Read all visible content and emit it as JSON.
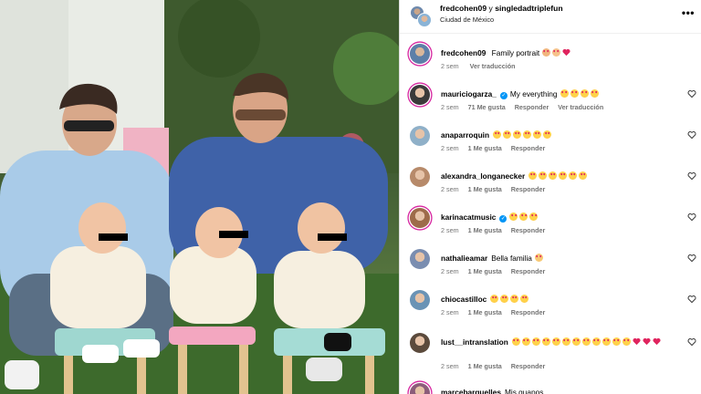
{
  "header": {
    "user1": "fredcohen09",
    "conj": "y",
    "user2": "singledadtriplefun",
    "location": "Ciudad de México",
    "more_icon": "more-horizontal-icon"
  },
  "caption": {
    "username": "fredcohen09",
    "text": "Family portrait",
    "emojis": [
      "man-face",
      "baby-face",
      "red-heart"
    ],
    "time": "2 sem",
    "translation": "Ver traducción"
  },
  "comments": [
    {
      "username": "mauriciogarza_",
      "verified": true,
      "text": "My everything",
      "emoji_count": 4,
      "time": "2 sem",
      "likes": "71 Me gusta",
      "reply": "Responder",
      "translation": "Ver traducción",
      "avatar_color": "#3a3a3a",
      "ring": true
    },
    {
      "username": "anaparroquin",
      "verified": false,
      "text": "",
      "emoji_count": 6,
      "time": "2 sem",
      "likes": "1 Me gusta",
      "reply": "Responder",
      "avatar_color": "#8fb0c8",
      "ring": false
    },
    {
      "username": "alexandra_longanecker",
      "verified": false,
      "text": "",
      "emoji_count": 6,
      "time": "2 sem",
      "likes": "1 Me gusta",
      "reply": "Responder",
      "avatar_color": "#b78a6a",
      "ring": false
    },
    {
      "username": "karinacatmusic",
      "verified": true,
      "text": "",
      "emoji_count": 3,
      "time": "2 sem",
      "likes": "1 Me gusta",
      "reply": "Responder",
      "avatar_color": "#9d6b4a",
      "ring": true
    },
    {
      "username": "nathalieamar",
      "verified": false,
      "text": "Bella familia",
      "emoji_count": 0,
      "wave": true,
      "time": "2 sem",
      "likes": "1 Me gusta",
      "reply": "Responder",
      "avatar_color": "#7a8db0",
      "ring": false
    },
    {
      "username": "chiocastilloc",
      "verified": false,
      "text": "",
      "emoji_count": 4,
      "time": "2 sem",
      "likes": "1 Me gusta",
      "reply": "Responder",
      "avatar_color": "#6a93b5",
      "ring": false
    },
    {
      "username": "lust__intranslation",
      "verified": false,
      "text": "",
      "emoji_count": 12,
      "hearts": 3,
      "time": "2 sem",
      "likes": "1 Me gusta",
      "reply": "Responder",
      "avatar_color": "#5b4a3c",
      "ring": false
    },
    {
      "username": "marcebarquelles",
      "verified": false,
      "text": "Mis guapos",
      "emoji_count": 0,
      "time": "",
      "likes": "",
      "reply": "",
      "avatar_color": "#8b5c7a",
      "ring": true
    }
  ],
  "colors": {
    "accent": "#0095f6",
    "muted": "#737373",
    "heart": "#ed4956"
  }
}
